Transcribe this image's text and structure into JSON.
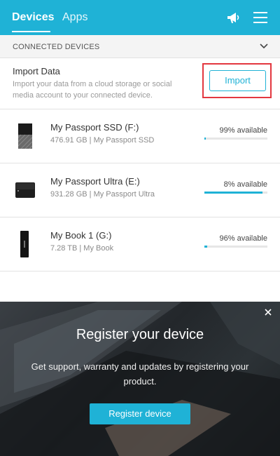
{
  "header": {
    "tabs": [
      {
        "label": "Devices",
        "active": true
      },
      {
        "label": "Apps",
        "active": false
      }
    ],
    "icons": [
      "megaphone-icon",
      "menu-icon"
    ]
  },
  "section": {
    "title": "CONNECTED DEVICES",
    "toggle_icon": "chevron-down-icon"
  },
  "import_data": {
    "title": "Import Data",
    "description": "Import your data from a cloud storage or social media account to your connected device.",
    "button_label": "Import"
  },
  "devices": [
    {
      "name": "My Passport SSD (F:)",
      "details": "476.91 GB | My Passport SSD",
      "available": "99% available",
      "available_fraction": 0.99,
      "used_fraction": 0.01
    },
    {
      "name": "My Passport Ultra (E:)",
      "details": "931.28 GB | My Passport Ultra",
      "available": "8% available",
      "available_fraction": 0.08,
      "used_fraction": 0.92
    },
    {
      "name": "My Book 1 (G:)",
      "details": "7.28 TB | My Book",
      "available": "96% available",
      "available_fraction": 0.96,
      "used_fraction": 0.04
    }
  ],
  "banner": {
    "title": "Register your device",
    "text": "Get support, warranty and updates by registering your product.",
    "button_label": "Register device"
  },
  "colors": {
    "accent": "#1fb2d6",
    "highlight_border": "#e3373f"
  }
}
